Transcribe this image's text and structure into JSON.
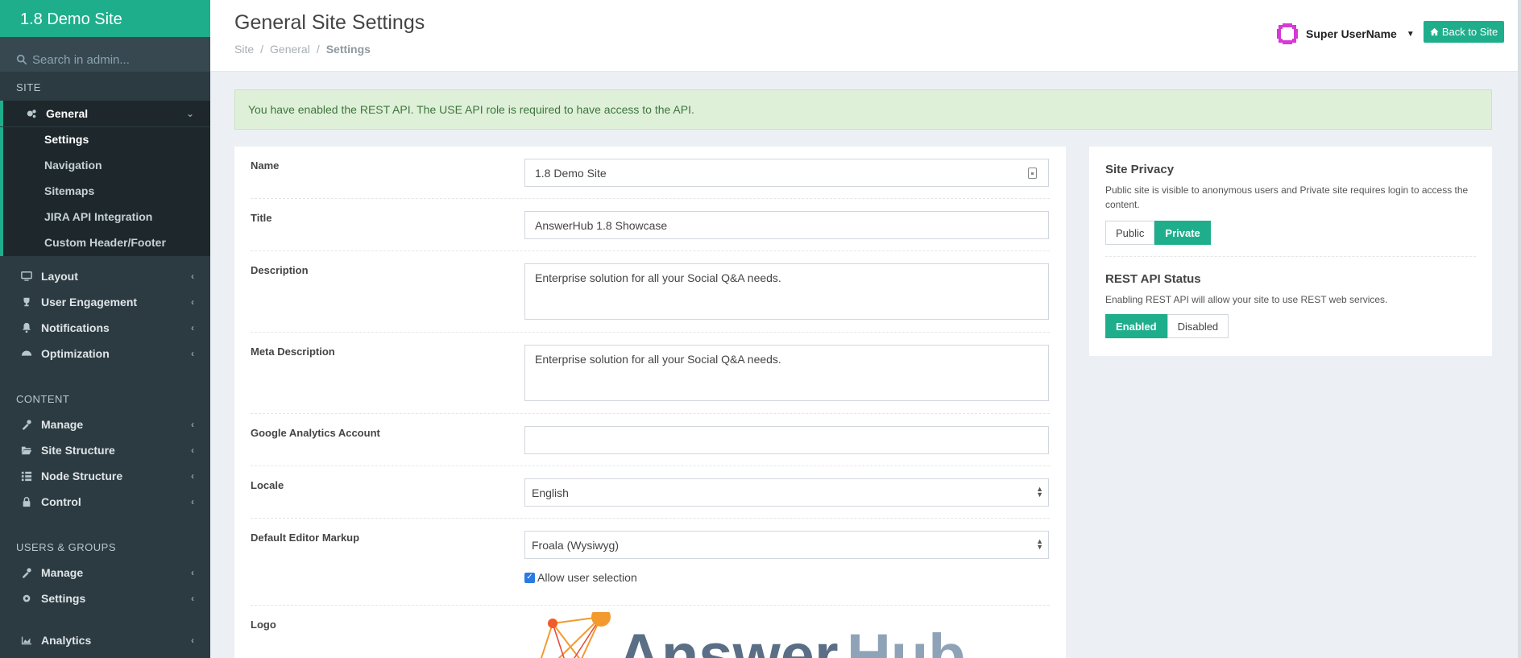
{
  "app": {
    "brand": "1.8 Demo Site"
  },
  "search": {
    "placeholder": "Search in admin..."
  },
  "sidebar": {
    "site_header": "SITE",
    "content_header": "CONTENT",
    "users_header": "USERS & GROUPS",
    "general": "General",
    "general_sub": [
      "Settings",
      "Navigation",
      "Sitemaps",
      "JIRA API Integration",
      "Custom Header/Footer"
    ],
    "layout": "Layout",
    "user_engagement": "User Engagement",
    "notifications": "Notifications",
    "optimization": "Optimization",
    "content_manage": "Manage",
    "site_structure": "Site Structure",
    "node_structure": "Node Structure",
    "control": "Control",
    "users_manage": "Manage",
    "users_settings": "Settings",
    "analytics": "Analytics"
  },
  "header": {
    "title": "General Site Settings",
    "breadcrumb": [
      "Site",
      "/",
      "General",
      "/",
      "Settings"
    ],
    "user_name": "Super UserName",
    "back_label": "Back to Site"
  },
  "alert": "You have enabled the REST API. The USE API role is required to have access to the API.",
  "form": {
    "name_label": "Name",
    "name_value": "1.8 Demo Site",
    "title_label": "Title",
    "title_value": "AnswerHub 1.8 Showcase",
    "description_label": "Description",
    "description_value": "Enterprise solution for all your Social Q&A needs.",
    "meta_label": "Meta Description",
    "meta_value": "Enterprise solution for all your Social Q&A needs.",
    "ga_label": "Google Analytics Account",
    "ga_value": "",
    "locale_label": "Locale",
    "locale_value": "English",
    "editor_label": "Default Editor Markup",
    "editor_value": "Froala (Wysiwyg)",
    "allow_label": "Allow user selection",
    "logo_label": "Logo",
    "logo_text_a": "Answer",
    "logo_text_b": "Hub"
  },
  "side": {
    "privacy_title": "Site Privacy",
    "privacy_desc": "Public site is visible to anonymous users and Private site requires login to access the content.",
    "public": "Public",
    "private": "Private",
    "rest_title": "REST API Status",
    "rest_desc": "Enabling REST API will allow your site to use REST web services.",
    "enabled": "Enabled",
    "disabled": "Disabled"
  },
  "colors": {
    "accent": "#1fae8c",
    "sidebar": "#2c3b41",
    "alert_bg": "#dff0d8",
    "avatar": "#d63ad6",
    "logo_orange": "#f39a2f",
    "logo_blue": "#5a6e86"
  }
}
